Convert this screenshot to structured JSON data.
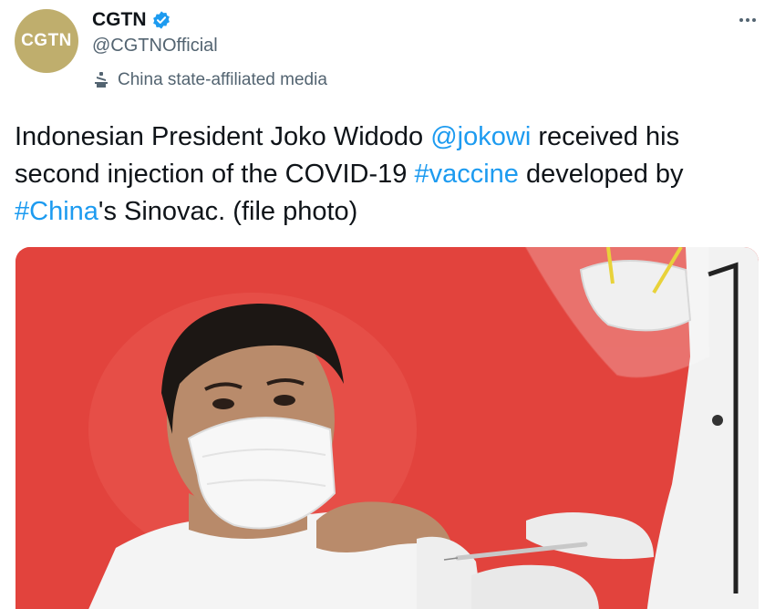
{
  "author": {
    "display_name": "CGTN",
    "handle": "@CGTNOfficial",
    "avatar_text": "CGTN",
    "verified": true,
    "label": "China state-affiliated media",
    "label_icon": "podium-icon",
    "avatar_color": "#bfae6d"
  },
  "tweet": {
    "segments": [
      {
        "text": "Indonesian President Joko Widodo ",
        "type": "text"
      },
      {
        "text": "@jokowi",
        "type": "mention"
      },
      {
        "text": " received his second injection of the COVID-19 ",
        "type": "text"
      },
      {
        "text": "#vaccine",
        "type": "hashtag"
      },
      {
        "text": " developed by ",
        "type": "text"
      },
      {
        "text": "#China",
        "type": "hashtag"
      },
      {
        "text": "'s Sinovac. (file photo)",
        "type": "text"
      }
    ]
  },
  "colors": {
    "link": "#1d9bf0",
    "secondary_text": "#536471",
    "photo_background": "#e2433d"
  },
  "icons": {
    "more": "more-options-icon",
    "verified": "verified-badge-icon"
  }
}
